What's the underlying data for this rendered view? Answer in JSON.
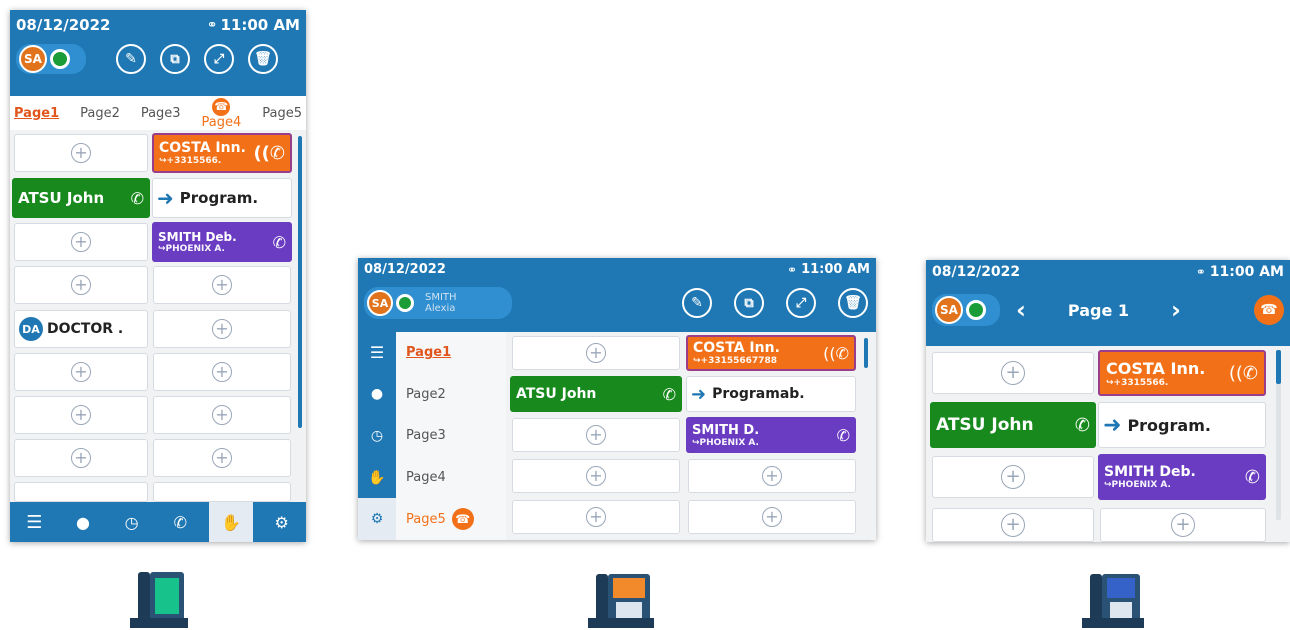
{
  "phone1": {
    "date": "08/12/2022",
    "time": "11:00 AM",
    "user_initials": "SA",
    "tabs": [
      "Page1",
      "Page2",
      "Page3",
      "Page4",
      "Page5"
    ],
    "keys": {
      "costa_name": "COSTA Inn.",
      "costa_number": "↪+3315566.",
      "atsu_name": "ATSU John",
      "program_label": "Program.",
      "smith_name": "SMITH Deb.",
      "smith_forward": "↪PHOENIX A.",
      "doctor_initials": "DA",
      "doctor_name": "DOCTOR ."
    }
  },
  "phone2": {
    "date": "08/12/2022",
    "time": "11:00 AM",
    "user_initials": "SA",
    "user_name_line1": "SMITH",
    "user_name_line2": "Alexia",
    "pages": [
      "Page1",
      "Page2",
      "Page3",
      "Page4",
      "Page5"
    ],
    "keys": {
      "costa_name": "COSTA Inn.",
      "costa_number": "↪+33155667788",
      "atsu_name": "ATSU John",
      "program_label": "Programab.",
      "smith_name": "SMITH D.",
      "smith_forward": "↪PHOENIX A."
    }
  },
  "phone3": {
    "date": "08/12/2022",
    "time": "11:00 AM",
    "user_initials": "SA",
    "page_title": "Page 1",
    "keys": {
      "costa_name": "COSTA Inn.",
      "costa_number": "↪+3315566.",
      "atsu_name": "ATSU John",
      "program_label": "Program.",
      "smith_name": "SMITH Deb.",
      "smith_forward": "↪PHOENIX A."
    }
  },
  "icons": {
    "headset": "headset-icon",
    "pencil": "pencil-icon",
    "copy": "copy-icon",
    "expand": "expand-icon",
    "trash": "trash-icon",
    "plus": "plus-icon",
    "ringing": "ringing-phone-icon",
    "handset": "handset-icon",
    "arrow": "arrow-right-icon"
  },
  "colors": {
    "primary": "#1f78b4",
    "orange": "#f27118",
    "green": "#188a1d",
    "purple": "#6a3cc2",
    "presence": "#1b9c36"
  }
}
